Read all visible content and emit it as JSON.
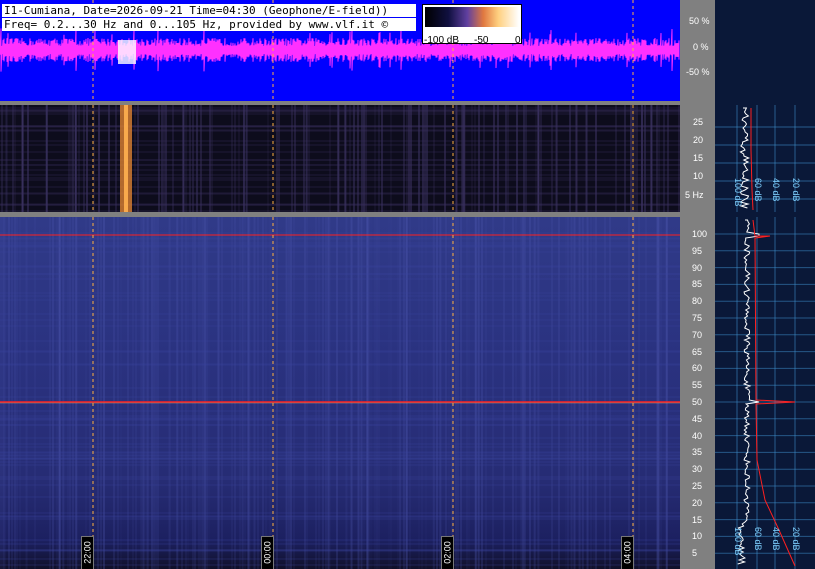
{
  "header": {
    "line1": "I1-Cumiana, Date=2026-09-21 Time=04:30 (Geophone/E-field))",
    "line2": "Freq= 0.2...30 Hz and 0...105 Hz, provided by www.vlf.it ©"
  },
  "colorbar": {
    "ticks": [
      "-100 dB",
      "-50",
      "0"
    ]
  },
  "waveform_axis": {
    "ticks": [
      "50 %",
      "0 %",
      "-50 %"
    ]
  },
  "spectrogram_top_axis": {
    "ticks": [
      "25",
      "20",
      "15",
      "10",
      "5 Hz"
    ]
  },
  "spectrogram_bottom_axis": {
    "ticks": [
      "100",
      "95",
      "90",
      "85",
      "80",
      "75",
      "70",
      "65",
      "60",
      "55",
      "50",
      "45",
      "40",
      "35",
      "30",
      "25",
      "20",
      "15",
      "10",
      "5"
    ]
  },
  "time_labels": [
    "22:00",
    "00:00",
    "02:00",
    "04:00"
  ],
  "profile_top_db_labels": [
    "100 dB",
    "60 dB",
    "40 dB",
    "20 dB"
  ],
  "profile_bottom_db_labels": [
    "100 dB",
    "60 dB",
    "40 dB",
    "20 dB"
  ],
  "colors": {
    "waveform_bg": "#0000ff",
    "waveform_signal": "#ff30ff",
    "panel_gray": "#808080",
    "spectro_bottom_bg": "#28307a",
    "spectro_top_bg": "#0d0c1c",
    "marker_line": "#ff2020",
    "time_cursor": "#ffb040",
    "profile_bg": "#0a1838",
    "profile_grid": "#3c8cc8"
  }
}
